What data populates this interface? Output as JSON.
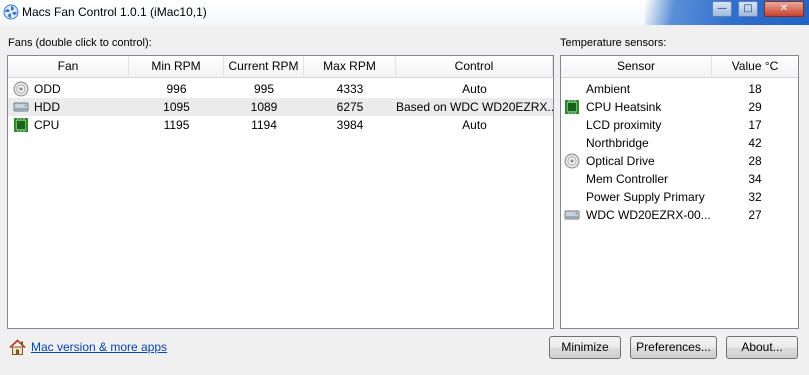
{
  "window": {
    "title": "Macs Fan Control 1.0.1 (iMac10,1)",
    "caption_minimize": "—",
    "caption_maximize": "□",
    "caption_close": "✕"
  },
  "fans": {
    "section_label": "Fans (double click to control):",
    "columns": [
      "Fan",
      "Min RPM",
      "Current RPM",
      "Max RPM",
      "Control"
    ],
    "rows": [
      {
        "icon": "optical-drive-icon",
        "name": "ODD",
        "min": "996",
        "current": "995",
        "max": "4333",
        "control": "Auto"
      },
      {
        "icon": "hard-drive-icon",
        "name": "HDD",
        "min": "1095",
        "current": "1089",
        "max": "6275",
        "control": "Based on WDC WD20EZRX..."
      },
      {
        "icon": "cpu-chip-icon",
        "name": "CPU",
        "min": "1195",
        "current": "1194",
        "max": "3984",
        "control": "Auto"
      }
    ]
  },
  "sensors": {
    "section_label": "Temperature sensors:",
    "columns": [
      "Sensor",
      "Value °C"
    ],
    "rows": [
      {
        "icon": "",
        "name": "Ambient",
        "value": "18"
      },
      {
        "icon": "cpu-chip-icon",
        "name": "CPU Heatsink",
        "value": "29"
      },
      {
        "icon": "",
        "name": "LCD proximity",
        "value": "17"
      },
      {
        "icon": "",
        "name": "Northbridge",
        "value": "42"
      },
      {
        "icon": "optical-drive-icon",
        "name": "Optical Drive",
        "value": "28"
      },
      {
        "icon": "",
        "name": "Mem Controller",
        "value": "34"
      },
      {
        "icon": "",
        "name": "Power Supply Primary",
        "value": "32"
      },
      {
        "icon": "hard-drive-icon",
        "name": "WDC WD20EZRX-00...",
        "value": "27"
      }
    ]
  },
  "footer": {
    "link_icon": "home-icon",
    "link_text": "Mac version & more apps",
    "minimize_label": "Minimize",
    "preferences_label": "Preferences...",
    "about_label": "About..."
  },
  "colors": {
    "link": "#0645ad",
    "row_highlight": "#ebebeb",
    "cpu_chip": "#2f8a2f"
  }
}
